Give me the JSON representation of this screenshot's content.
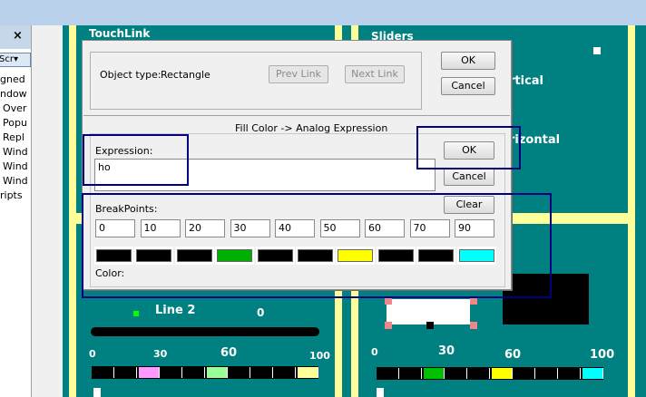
{
  "left_panel": {
    "close_label": "×",
    "selected_item": "Scr▾",
    "items": [
      "gned",
      "ndow",
      "Over",
      "Popu",
      "Repl",
      "Wind",
      "Wind",
      "Wind",
      "ripts"
    ]
  },
  "canvas": {
    "touchlink_label": "TouchLink",
    "sliders_label": "Sliders",
    "vertical_label": "rtical",
    "horizontal_label": "rizontal",
    "line2_label": "Line 2",
    "line2_value": "0",
    "left_slider": {
      "ticks": [
        "0",
        "30",
        "60",
        "100"
      ],
      "colors": [
        "#000000",
        "#000000",
        "#ff99ff",
        "#000000",
        "#000000",
        "#99ff99",
        "#000000",
        "#000000",
        "#000000",
        "#ffff99"
      ]
    },
    "right_slider": {
      "ticks": [
        "0",
        "30",
        "60",
        "100"
      ],
      "colors": [
        "#000000",
        "#000000",
        "#00c000",
        "#000000",
        "#000000",
        "#ffff00",
        "#000000",
        "#000000",
        "#000000",
        "#00ffff"
      ]
    }
  },
  "dialog": {
    "object_type_label": "Object type:",
    "object_type_value": "Rectangle",
    "prev_link": "Prev Link",
    "next_link": "Next Link",
    "ok_top": "OK",
    "cancel_top": "Cancel",
    "title": "Fill Color -> Analog Expression",
    "expression_label": "Expression:",
    "expression_value": "ho",
    "ok": "OK",
    "cancel": "Cancel",
    "clear": "Clear",
    "breakpoints_label": "BreakPoints:",
    "breakpoints": [
      "0",
      "10",
      "20",
      "30",
      "40",
      "50",
      "60",
      "70",
      "90"
    ],
    "colors": [
      "#000000",
      "#000000",
      "#000000",
      "#00b000",
      "#000000",
      "#000000",
      "#ffff00",
      "#000000",
      "#000000",
      "#00ffff"
    ],
    "color_label": "Color:"
  }
}
